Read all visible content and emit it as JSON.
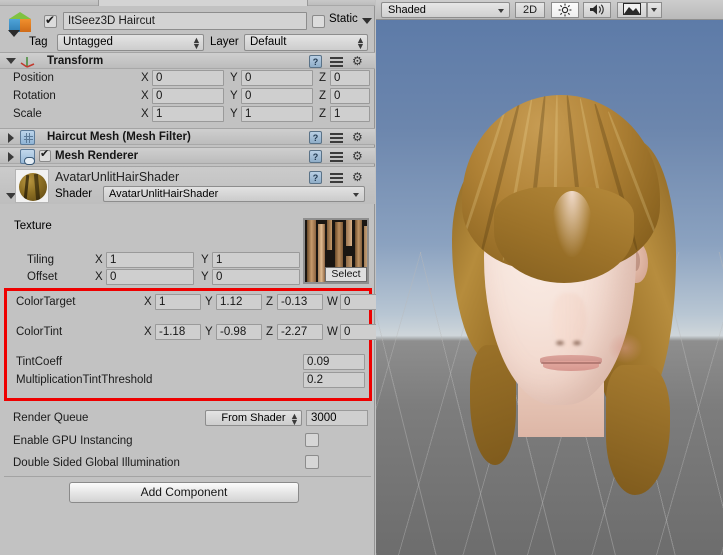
{
  "inspector": {
    "object": {
      "icon": "prefab-cube-icon",
      "enabled_checkbox": true,
      "name": "ItSeez3D Haircut",
      "static_label": "Static",
      "static_checkbox": false,
      "tag_label": "Tag",
      "tag_value": "Untagged",
      "layer_label": "Layer",
      "layer_value": "Default"
    },
    "transform": {
      "title": "Transform",
      "expanded": true,
      "rows": [
        {
          "label": "Position",
          "x": "0",
          "y": "0",
          "z": "0"
        },
        {
          "label": "Rotation",
          "x": "0",
          "y": "0",
          "z": "0"
        },
        {
          "label": "Scale",
          "x": "1",
          "y": "1",
          "z": "1"
        }
      ],
      "axis": {
        "x": "X",
        "y": "Y",
        "z": "Z",
        "w": "W"
      }
    },
    "mesh_filter": {
      "title": "Haircut Mesh (Mesh Filter)",
      "expanded": false
    },
    "mesh_renderer": {
      "title": "Mesh Renderer",
      "expanded": false,
      "enabled": true
    },
    "material": {
      "name": "AvatarUnlitHairShader",
      "shader_label": "Shader",
      "shader_value": "AvatarUnlitHairShader"
    },
    "texture": {
      "label": "Texture",
      "tiling_label": "Tiling",
      "tiling_x": "1",
      "tiling_y": "1",
      "offset_label": "Offset",
      "offset_x": "0",
      "offset_y": "0",
      "select_label": "Select"
    },
    "highlighted": {
      "border_color": "#ee0000",
      "color_target": {
        "label": "ColorTarget",
        "x": "1",
        "y": "1.12",
        "z": "-0.13",
        "w": "0"
      },
      "color_tint": {
        "label": "ColorTint",
        "x": "-1.18",
        "y": "-0.98",
        "z": "-2.27",
        "w": "0"
      },
      "tint_coeff": {
        "label": "TintCoeff",
        "value": "0.09"
      },
      "mult_threshold": {
        "label": "MultiplicationTintThreshold",
        "value": "0.2"
      }
    },
    "render_settings": {
      "render_queue_label": "Render Queue",
      "render_queue_mode": "From Shader",
      "render_queue_value": "3000",
      "gpu_instancing_label": "Enable GPU Instancing",
      "gpu_instancing_checked": false,
      "double_sided_label": "Double Sided Global Illumination",
      "double_sided_checked": false
    },
    "add_component_label": "Add Component"
  },
  "scene": {
    "toolbar": {
      "draw_mode": "Shaded",
      "view_mode": "2D",
      "lighting_icon": "sun-icon",
      "audio_icon": "speaker-icon",
      "effects_icon": "image-effects-icon",
      "effects_dropdown_icon": "chevron-down-icon"
    },
    "content_description": "3D avatar head with golden-brown hair on gray grid ground with blue sky gradient"
  }
}
